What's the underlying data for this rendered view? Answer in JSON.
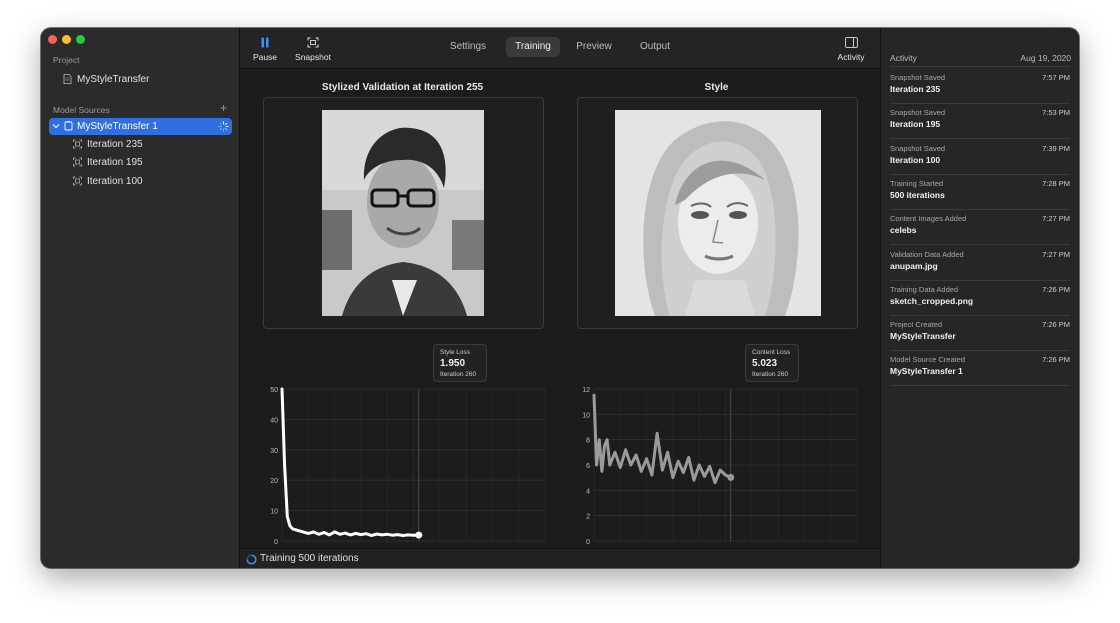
{
  "sidebar": {
    "project_title": "Project",
    "project_name": "MyStyleTransfer",
    "model_sources_title": "Model Sources",
    "add_label": "+",
    "model_source": "MyStyleTransfer 1",
    "iterations": [
      "Iteration 235",
      "Iteration 195",
      "Iteration 100"
    ]
  },
  "toolbar": {
    "pause_label": "Pause",
    "snapshot_label": "Snapshot",
    "activity_label": "Activity",
    "tabs": [
      "Settings",
      "Training",
      "Preview",
      "Output"
    ],
    "active_tab": "Training"
  },
  "panels": {
    "left_title": "Stylized Validation at Iteration 255",
    "right_title": "Style"
  },
  "tooltips": {
    "style": {
      "label": "Style Loss",
      "value": "1.950",
      "iteration": "Iteration 260"
    },
    "content": {
      "label": "Content Loss",
      "value": "5.023",
      "iteration": "Iteration 260"
    }
  },
  "status": {
    "text": "Training 500 iterations"
  },
  "activity": {
    "title": "Activity",
    "date": "Aug 19, 2020",
    "items": [
      {
        "title": "Snapshot Saved",
        "time": "7:57 PM",
        "detail": "Iteration 235"
      },
      {
        "title": "Snapshot Saved",
        "time": "7:53 PM",
        "detail": "Iteration 195"
      },
      {
        "title": "Snapshot Saved",
        "time": "7:39 PM",
        "detail": "Iteration 100"
      },
      {
        "title": "Training Started",
        "time": "7:28 PM",
        "detail": "500 iterations"
      },
      {
        "title": "Content Images Added",
        "time": "7:27 PM",
        "detail": "celebs"
      },
      {
        "title": "Validation Data Added",
        "time": "7:27 PM",
        "detail": "anupam.jpg"
      },
      {
        "title": "Training Data Added",
        "time": "7:26 PM",
        "detail": "sketch_cropped.png"
      },
      {
        "title": "Project Created",
        "time": "7:26 PM",
        "detail": "MyStyleTransfer"
      },
      {
        "title": "Model Source Created",
        "time": "7:26 PM",
        "detail": "MyStyleTransfer 1"
      }
    ]
  },
  "chart_data": [
    {
      "type": "line",
      "name": "style-loss",
      "ylim": [
        0,
        50
      ],
      "yticks": [
        0,
        10,
        20,
        30,
        40,
        50
      ],
      "xlim": [
        0,
        500
      ],
      "marker_x": 260,
      "x": [
        0,
        5,
        10,
        15,
        20,
        30,
        40,
        50,
        60,
        70,
        80,
        90,
        100,
        110,
        120,
        130,
        140,
        150,
        160,
        170,
        180,
        190,
        200,
        210,
        220,
        230,
        240,
        250,
        260
      ],
      "y": [
        50,
        25,
        8,
        5,
        4,
        3.5,
        3,
        2.5,
        3,
        2.2,
        2.8,
        2,
        3,
        2.2,
        2.6,
        2,
        2.5,
        2.1,
        2.4,
        1.8,
        2.3,
        2,
        2.2,
        1.9,
        2.1,
        1.8,
        2,
        1.9,
        1.95
      ],
      "color": "#ffffff"
    },
    {
      "type": "line",
      "name": "content-loss",
      "ylim": [
        0,
        12
      ],
      "yticks": [
        0,
        2,
        4,
        6,
        8,
        10,
        12
      ],
      "xlim": [
        0,
        500
      ],
      "marker_x": 260,
      "x": [
        0,
        5,
        10,
        15,
        20,
        25,
        30,
        40,
        50,
        60,
        70,
        80,
        90,
        100,
        110,
        120,
        130,
        140,
        150,
        160,
        170,
        180,
        190,
        200,
        210,
        220,
        230,
        240,
        250,
        260
      ],
      "y": [
        11.5,
        6,
        8,
        5.5,
        7.5,
        8,
        6,
        7,
        5.8,
        7.2,
        6,
        6.8,
        5.5,
        6.5,
        5.2,
        8.5,
        5.6,
        7,
        5,
        6.3,
        5.4,
        6.6,
        4.8,
        6,
        5.1,
        5.9,
        4.6,
        5.6,
        5.2,
        5.02
      ],
      "color": "#9a9a9a"
    }
  ]
}
